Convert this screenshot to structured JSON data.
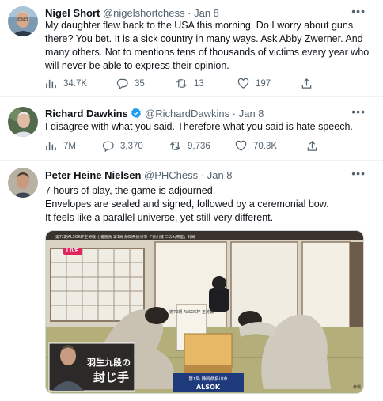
{
  "tweets": [
    {
      "name": "Nigel Short",
      "handle": "@nigelshortchess",
      "date": "Jan 8",
      "lines": [
        "My daughter flew back to the USA this morning. Do I worry about guns",
        "there? You bet. It is a sick country in many ways. Ask Abby Zwerner. And",
        "many others. Not to mentions tens of thousands of victims every year who",
        "will never be able to express their opinion."
      ],
      "views": "34.7K",
      "replies": "35",
      "retweets": "13",
      "likes": "197"
    },
    {
      "name": "Richard Dawkins",
      "handle": "@RichardDawkins",
      "date": "Jan 8",
      "lines": [
        "I disagree with what you said. Therefore what you said is hate speech."
      ],
      "views": "7M",
      "replies": "3,370",
      "retweets": "9,736",
      "likes": "70.3K"
    },
    {
      "name": "Peter Heine Nielsen",
      "handle": "@PHChess",
      "date": "Jan 8",
      "lines": [
        "7 hours of play, the game is adjourned.",
        "Envelopes are sealed and signed, followed by a ceremonial bow.",
        "It feels like a parallel universe, yet still very different."
      ],
      "media": {
        "live_badge": "LIVE",
        "caption_line1": "羽生九段の",
        "caption_line2": "封じ手",
        "banner_title": "第72期ALSOK杯王将戦 七番勝負 第1局 静岡県掛川市 「掛川城 二の丸茶室」対局",
        "sign_vertical": "第72期 ALSOK杯 王將戰",
        "table_logo": "ALSOK",
        "table_banner": "第1局 静岡県掛川市",
        "corner_mark": "参戦"
      }
    }
  ],
  "dot": "·",
  "more_icon": "more-horizontal-icon",
  "colors": {
    "text": "#0f1419",
    "muted": "#536471",
    "verified": "#1d9bf0",
    "live": "#e0245e"
  }
}
